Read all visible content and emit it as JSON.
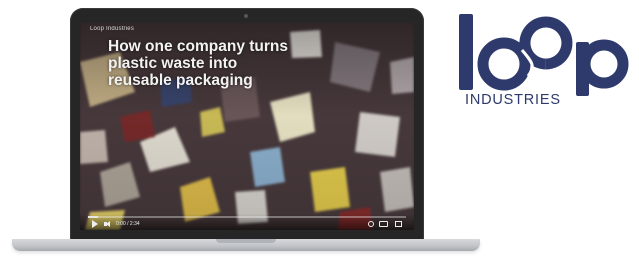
{
  "video": {
    "channel": "Loop Industries",
    "headline": "How one company turns\nplastic waste into\nreusable packaging",
    "progress": 0.03,
    "time_label": "0:00 / 2:34",
    "colors": {
      "player_controls": "#eeeeee",
      "progress_track": "#bbbbbb"
    }
  },
  "logo": {
    "wordmark": "loop",
    "tagline": "INDUSTRIES",
    "color": "#2d3a6b"
  },
  "laptop": {
    "bezel_color": "#262626",
    "base_color": "#c2c5c9"
  },
  "icons": {
    "play": "play-icon",
    "volume": "volume-icon",
    "settings": "gear-icon",
    "captions": "captions-icon",
    "fullscreen": "fullscreen-icon"
  }
}
